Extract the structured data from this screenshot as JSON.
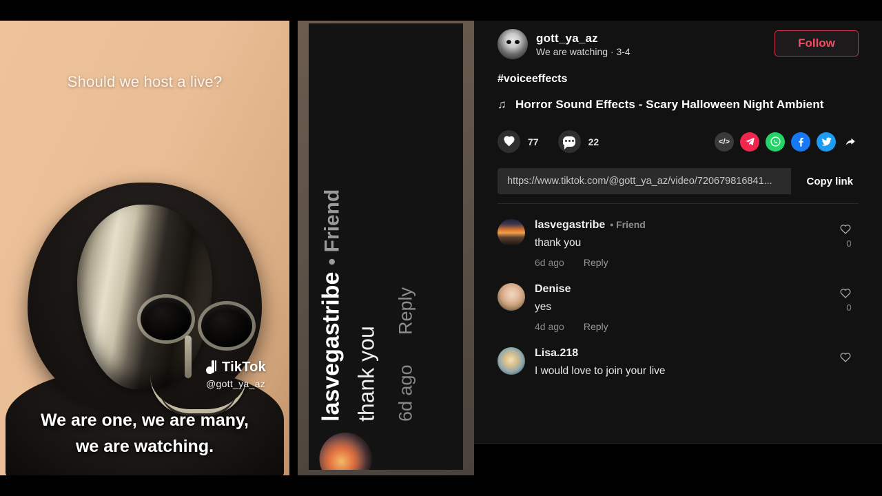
{
  "video": {
    "top_text": "Should we host a live?",
    "caption_line1": "We are one, we are many,",
    "caption_line2": "we are watching.",
    "watermark_brand": "TikTok",
    "watermark_handle": "@gott_ya_az"
  },
  "zoom_panel": {
    "name": "lasvegastribe",
    "badge": "• Friend",
    "text": "thank you",
    "time": "6d ago",
    "reply": "Reply"
  },
  "info": {
    "author_name": "gott_ya_az",
    "author_sub": "We are watching · 3-4",
    "follow_label": "Follow",
    "hashtag": "#voiceeffects",
    "music_icon": "♫",
    "music_title": "Horror Sound Effects - Scary Halloween Night Ambient",
    "like_count": "77",
    "comment_count": "22",
    "share_icons": [
      {
        "name": "embed-code-icon",
        "glyph": "</>",
        "color": "#3a3a3a"
      },
      {
        "name": "telegram-icon",
        "glyph": "➤",
        "color": "#f0264e"
      },
      {
        "name": "whatsapp-icon",
        "glyph": "✆",
        "color": "#25d366"
      },
      {
        "name": "facebook-icon",
        "glyph": "f",
        "color": "#1877f2"
      },
      {
        "name": "twitter-icon",
        "glyph": "🐦",
        "color": "#1d9bf0"
      },
      {
        "name": "share-arrow-icon",
        "glyph": "➦",
        "color": "transparent"
      }
    ],
    "link_url": "https://www.tiktok.com/@gott_ya_az/video/720679816841...",
    "copy_label": "Copy link"
  },
  "comments": [
    {
      "name": "lasvegastribe",
      "badge": "• Friend",
      "text": "thank you",
      "time": "6d ago",
      "reply": "Reply",
      "likes": "0",
      "avatar": "sunset"
    },
    {
      "name": "Denise",
      "badge": "",
      "text": "yes",
      "time": "4d ago",
      "reply": "Reply",
      "likes": "0",
      "avatar": "denise"
    },
    {
      "name": "Lisa.218",
      "badge": "",
      "text": "I would love to join your live",
      "time": "",
      "reply": "",
      "likes": "",
      "avatar": "lisa"
    }
  ],
  "colors": {
    "accent_red": "#f34b62",
    "panel_bg": "#121212",
    "page_bg": "#000000"
  }
}
